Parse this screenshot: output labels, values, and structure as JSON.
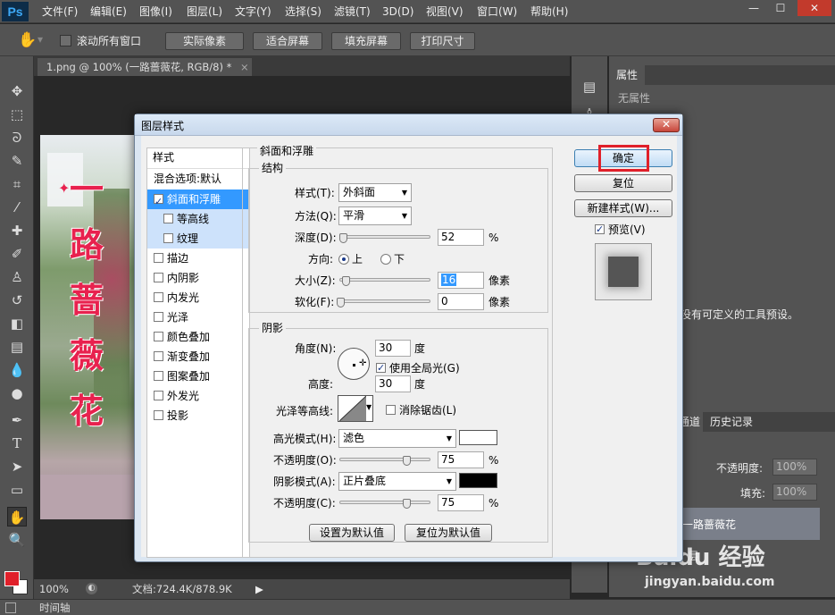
{
  "app": {
    "logo": "Ps",
    "menu": [
      "文件(F)",
      "编辑(E)",
      "图像(I)",
      "图层(L)",
      "文字(Y)",
      "选择(S)",
      "滤镜(T)",
      "3D(D)",
      "视图(V)",
      "窗口(W)",
      "帮助(H)"
    ],
    "window_controls": [
      "—",
      "☐",
      "✕"
    ]
  },
  "options_bar": {
    "scroll_all_label": "滚动所有窗口",
    "buttons": [
      "实际像素",
      "适合屏幕",
      "填充屏幕",
      "打印尺寸"
    ]
  },
  "document": {
    "tab_title": "1.png @ 100% (一路蔷薇花, RGB/8) *",
    "image_text": [
      "一",
      "路",
      "蔷",
      "薇",
      "花"
    ],
    "zoom": "100%",
    "doc_info": "文档:724.4K/878.9K"
  },
  "timeline_label": "时间轴",
  "right_panel": {
    "properties_tab": "属性",
    "no_properties": "无属性",
    "preset_text": "没有可定义的工具预设。",
    "channels_tab": "通道",
    "history_tab": "历史记录",
    "opacity_label": "不透明度:",
    "opacity_value": "100%",
    "fill_label": "填充:",
    "fill_value": "100%",
    "layer_name": "一路蔷薇花",
    "bg_layer_partial": "层",
    "watermark_top": "Baidu 经验",
    "watermark_bottom": "jingyan.baidu.com"
  },
  "dialog": {
    "title": "图层样式",
    "styles_header": "样式",
    "blend_options": "混合选项:默认",
    "styles": [
      {
        "label": "斜面和浮雕",
        "checked": true,
        "selected": true
      },
      {
        "label": "等高线",
        "checked": false,
        "sub": true
      },
      {
        "label": "纹理",
        "checked": false,
        "sub": true
      },
      {
        "label": "描边",
        "checked": false
      },
      {
        "label": "内阴影",
        "checked": false
      },
      {
        "label": "内发光",
        "checked": false
      },
      {
        "label": "光泽",
        "checked": false
      },
      {
        "label": "颜色叠加",
        "checked": false
      },
      {
        "label": "渐变叠加",
        "checked": false
      },
      {
        "label": "图案叠加",
        "checked": false
      },
      {
        "label": "外发光",
        "checked": false
      },
      {
        "label": "投影",
        "checked": false
      }
    ],
    "section_title": "斜面和浮雕",
    "structure": {
      "title": "结构",
      "style_label": "样式(T):",
      "style_value": "外斜面",
      "technique_label": "方法(Q):",
      "technique_value": "平滑",
      "depth_label": "深度(D):",
      "depth_value": "52",
      "depth_unit": "%",
      "depth_level": 0.03,
      "direction_label": "方向:",
      "dir_up": "上",
      "dir_down": "下",
      "size_label": "大小(Z):",
      "size_value": "16",
      "size_unit": "像素",
      "size_level": 0.06,
      "soften_label": "软化(F):",
      "soften_value": "0",
      "soften_unit": "像素",
      "soften_level": 0.0
    },
    "shading": {
      "title": "阴影",
      "angle_label": "角度(N):",
      "angle_value": "30",
      "angle_unit": "度",
      "global_light_label": "使用全局光(G)",
      "global_light_checked": true,
      "altitude_label": "高度:",
      "altitude_value": "30",
      "altitude_unit": "度",
      "gloss_contour_label": "光泽等高线:",
      "antialias_label": "消除锯齿(L)",
      "highlight_mode_label": "高光模式(H):",
      "highlight_mode_value": "滤色",
      "highlight_color": "#ffffff",
      "highlight_opacity_label": "不透明度(O):",
      "highlight_opacity_value": "75",
      "highlight_opacity_unit": "%",
      "highlight_opacity_level": 0.75,
      "shadow_mode_label": "阴影模式(A):",
      "shadow_mode_value": "正片叠底",
      "shadow_color": "#000000",
      "shadow_opacity_label": "不透明度(C):",
      "shadow_opacity_value": "75",
      "shadow_opacity_unit": "%",
      "shadow_opacity_level": 0.75
    },
    "make_default": "设置为默认值",
    "reset_default": "复位为默认值",
    "ok": "确定",
    "reset": "复位",
    "new_style": "新建样式(W)...",
    "preview_label": "预览(V)",
    "preview_checked": true
  },
  "colors": {
    "accent_red": "#e0202a",
    "image_text_color": "#e8214e"
  }
}
